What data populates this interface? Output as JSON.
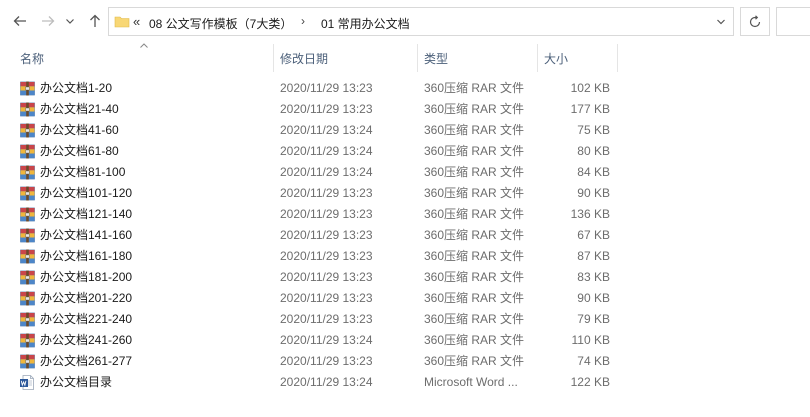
{
  "address": {
    "crumbs": [
      "08 公文写作模板（7大类）",
      "01 常用办公文档"
    ],
    "overflow_glyph": "«",
    "separator_glyph": "›"
  },
  "columns": {
    "name": "名称",
    "date": "修改日期",
    "type": "类型",
    "size": "大小"
  },
  "files": [
    {
      "name": "办公文档1-20",
      "date": "2020/11/29 13:23",
      "type": "360压缩 RAR 文件",
      "size": "102 KB",
      "icon": "rar-archive-icon"
    },
    {
      "name": "办公文档21-40",
      "date": "2020/11/29 13:23",
      "type": "360压缩 RAR 文件",
      "size": "177 KB",
      "icon": "rar-archive-icon"
    },
    {
      "name": "办公文档41-60",
      "date": "2020/11/29 13:24",
      "type": "360压缩 RAR 文件",
      "size": "75 KB",
      "icon": "rar-archive-icon"
    },
    {
      "name": "办公文档61-80",
      "date": "2020/11/29 13:24",
      "type": "360压缩 RAR 文件",
      "size": "80 KB",
      "icon": "rar-archive-icon"
    },
    {
      "name": "办公文档81-100",
      "date": "2020/11/29 13:24",
      "type": "360压缩 RAR 文件",
      "size": "84 KB",
      "icon": "rar-archive-icon"
    },
    {
      "name": "办公文档101-120",
      "date": "2020/11/29 13:23",
      "type": "360压缩 RAR 文件",
      "size": "90 KB",
      "icon": "rar-archive-icon"
    },
    {
      "name": "办公文档121-140",
      "date": "2020/11/29 13:23",
      "type": "360压缩 RAR 文件",
      "size": "136 KB",
      "icon": "rar-archive-icon"
    },
    {
      "name": "办公文档141-160",
      "date": "2020/11/29 13:23",
      "type": "360压缩 RAR 文件",
      "size": "67 KB",
      "icon": "rar-archive-icon"
    },
    {
      "name": "办公文档161-180",
      "date": "2020/11/29 13:23",
      "type": "360压缩 RAR 文件",
      "size": "87 KB",
      "icon": "rar-archive-icon"
    },
    {
      "name": "办公文档181-200",
      "date": "2020/11/29 13:23",
      "type": "360压缩 RAR 文件",
      "size": "83 KB",
      "icon": "rar-archive-icon"
    },
    {
      "name": "办公文档201-220",
      "date": "2020/11/29 13:23",
      "type": "360压缩 RAR 文件",
      "size": "90 KB",
      "icon": "rar-archive-icon"
    },
    {
      "name": "办公文档221-240",
      "date": "2020/11/29 13:23",
      "type": "360压缩 RAR 文件",
      "size": "79 KB",
      "icon": "rar-archive-icon"
    },
    {
      "name": "办公文档241-260",
      "date": "2020/11/29 13:24",
      "type": "360压缩 RAR 文件",
      "size": "110 KB",
      "icon": "rar-archive-icon"
    },
    {
      "name": "办公文档261-277",
      "date": "2020/11/29 13:23",
      "type": "360压缩 RAR 文件",
      "size": "74 KB",
      "icon": "rar-archive-icon"
    },
    {
      "name": "办公文档目录",
      "date": "2020/11/29 13:24",
      "type": "Microsoft Word ...",
      "size": "122 KB",
      "icon": "word-document-icon"
    }
  ],
  "colors": {
    "header_text": "#4c607a",
    "secondary_text": "#6d6d6d",
    "border": "#d9d9d9",
    "folder": "#f8d775",
    "word_blue": "#2b579a"
  }
}
